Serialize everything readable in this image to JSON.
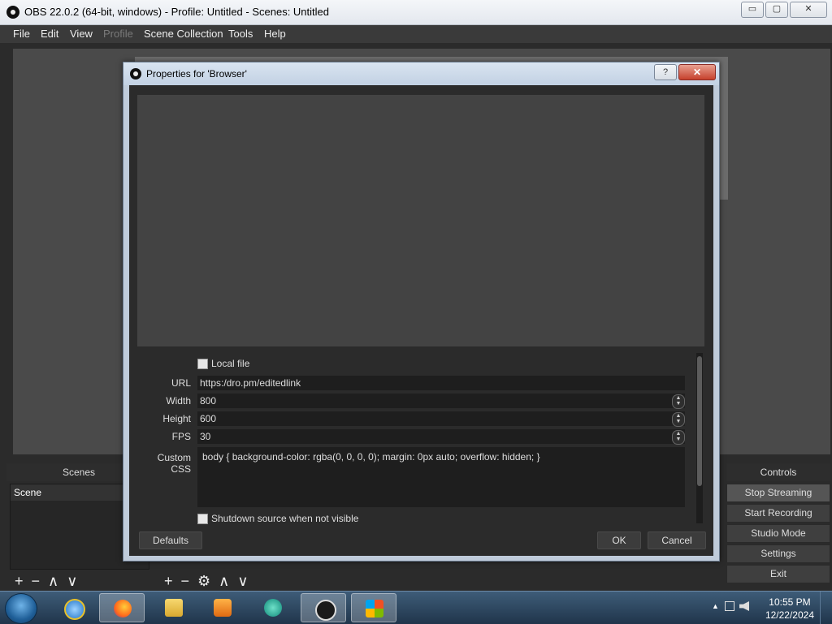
{
  "window": {
    "title": "OBS 22.0.2 (64-bit, windows) - Profile: Untitled - Scenes: Untitled",
    "min": "▭",
    "max": "▢",
    "close": "✕"
  },
  "menu": {
    "items": [
      "File",
      "Edit",
      "View",
      "Profile",
      "Scene Collection",
      "Tools",
      "Help"
    ],
    "disabled": "Profile"
  },
  "docks": {
    "scenes_title": "Scenes",
    "scene_items": [
      "Scene"
    ],
    "controls_title": "Controls",
    "toolbar_glyphs": {
      "add": "+",
      "remove": "−",
      "up": "∧",
      "down": "∨",
      "settings": "⚙"
    }
  },
  "controls": [
    "Stop Streaming",
    "Start Recording",
    "Studio Mode",
    "Settings",
    "Exit"
  ],
  "dialog": {
    "title": "Properties for 'Browser'",
    "help": "?",
    "close": "✕",
    "local_file_label": "Local file",
    "url_label": "URL",
    "url_value": "https:/dro.pm/editedlink",
    "width_label": "Width",
    "width_value": "800",
    "height_label": "Height",
    "height_value": "600",
    "fps_label": "FPS",
    "fps_value": "30",
    "css_label": "Custom CSS",
    "css_value": "body { background-color: rgba(0, 0, 0, 0); margin: 0px auto; overflow: hidden; }",
    "shutdown_label": "Shutdown source when not visible",
    "defaults": "Defaults",
    "ok": "OK",
    "cancel": "Cancel"
  },
  "taskbar": {
    "apps": [
      "ie-icon",
      "firefox-icon",
      "explorer-icon",
      "media-player-icon",
      "chat-icon",
      "obs-icon",
      "windows-icon"
    ],
    "time": "10:55 PM",
    "date": "12/22/2024",
    "tray_arrow": "▲"
  }
}
